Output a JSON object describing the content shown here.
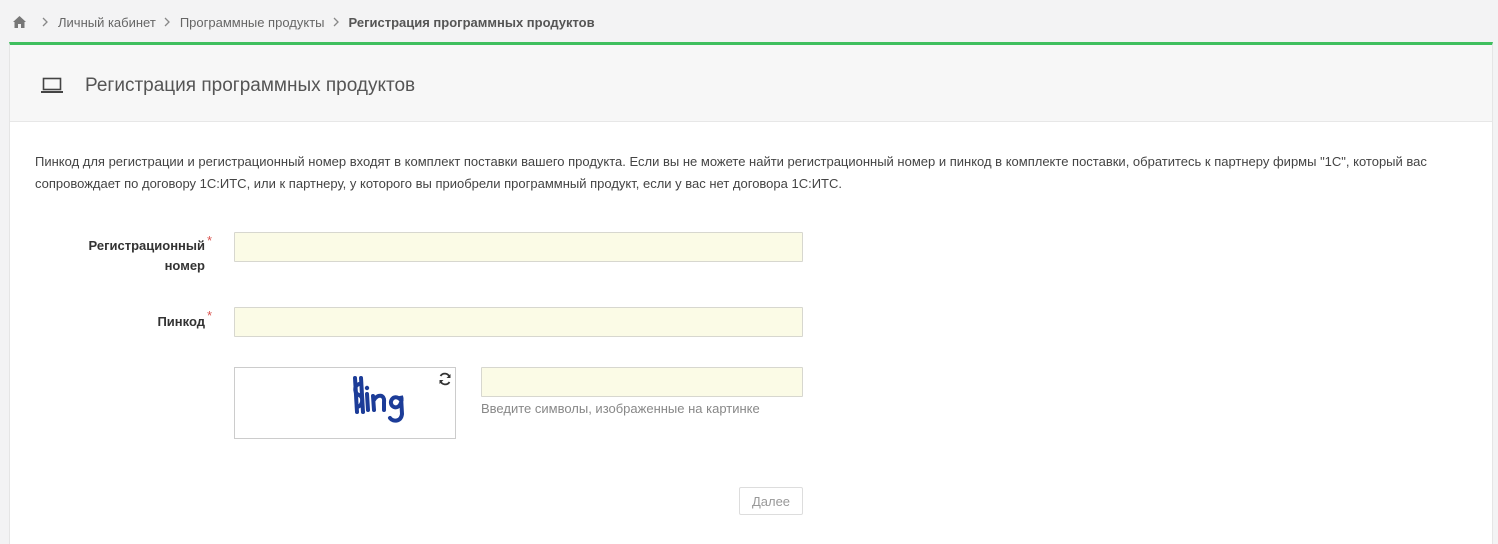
{
  "breadcrumb": {
    "home_icon": "home-icon",
    "items": [
      "Личный кабинет",
      "Программные продукты"
    ],
    "current": "Регистрация программных продуктов"
  },
  "panel": {
    "accent_color": "#3fbf5e",
    "icon": "laptop-icon",
    "title": "Регистрация программных продуктов"
  },
  "intro_text": "Пинкод для регистрации и регистрационный номер входят в комплект поставки вашего продукта. Если вы не можете найти регистрационный номер и пинкод в комплекте поставки, обратитесь к партнеру фирмы \"1С\", который вас сопровождает по договору 1С:ИТС, или к партнеру, у которого вы приобрели программный продукт, если у вас нет договора 1С:ИТС.",
  "form": {
    "reg_number": {
      "label": "Регистрационный номер",
      "required_mark": "*",
      "value": ""
    },
    "pincode": {
      "label": "Пинкод",
      "required_mark": "*",
      "value": ""
    },
    "captcha": {
      "refresh_icon": "refresh-icon",
      "image_text": "ising",
      "value": "",
      "hint": "Введите символы, изображенные на картинке"
    },
    "submit_label": "Далее"
  }
}
